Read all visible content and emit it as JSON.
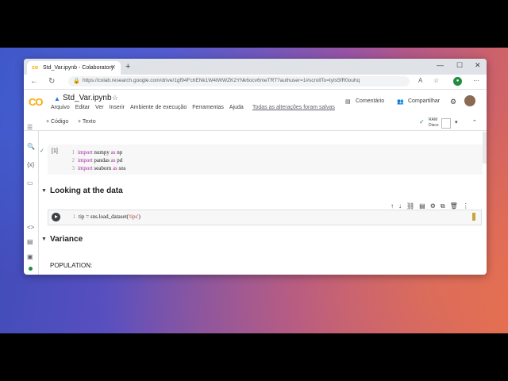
{
  "browser": {
    "tab_title": "Std_Var.ipynb - Colaboratory",
    "tab_icon": "colab-icon",
    "url": "https://colab.research.google.com/drive/1gf94FchENk1W4tWWZK2YNk6ocv6meTRT?authuser=1#scrollTo=tyIs5fR0ouhq"
  },
  "colab": {
    "logo": "CO",
    "notebook_title": "Std_Var.ipynb",
    "menu": [
      "Arquivo",
      "Editar",
      "Ver",
      "Inserir",
      "Ambiente de execução",
      "Ferramentas",
      "Ajuda"
    ],
    "saved_status": "Todas as alterações foram salvas",
    "comment_label": "Comentário",
    "share_label": "Compartilhar",
    "toolbar": {
      "add_code": "+ Código",
      "add_text": "+ Texto",
      "ram_label": "RAM",
      "disk_label": "Disco"
    }
  },
  "cells": {
    "cell1": {
      "exec_count": "[1]",
      "lines": [
        {
          "n": "1",
          "kw": "import",
          "rest": " numpy ",
          "kw2": "as",
          "rest2": " np"
        },
        {
          "n": "2",
          "kw": "import",
          "rest": " pandas ",
          "kw2": "as",
          "rest2": " pd"
        },
        {
          "n": "3",
          "kw": "import",
          "rest": " seaborn ",
          "kw2": "as",
          "rest2": " sns"
        }
      ]
    },
    "section1": "Looking at the data",
    "cell2": {
      "n": "1",
      "code_a": "tip = sns.load_dataset(",
      "code_str": "'tips'",
      "code_b": ")"
    },
    "section2": "Variance",
    "population_label": "POPULATION:"
  }
}
